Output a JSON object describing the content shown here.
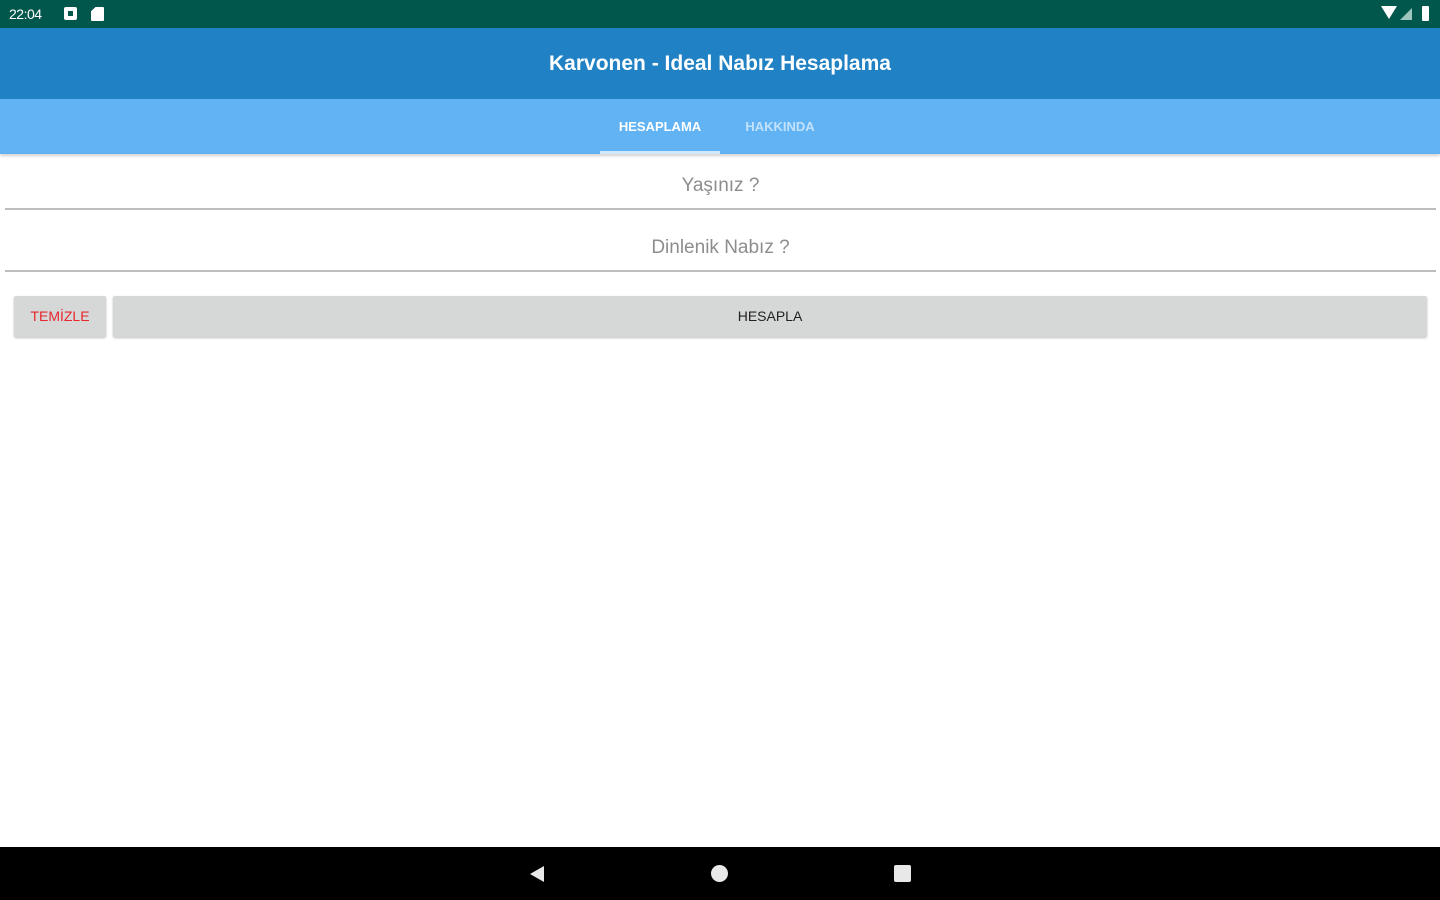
{
  "status_bar": {
    "time": "22:04",
    "icons": [
      "notification-icon",
      "sd-card-icon",
      "wifi-icon",
      "signal-icon",
      "battery-icon"
    ]
  },
  "app_bar": {
    "title": "Karvonen - Ideal Nabız Hesaplama",
    "color": "#2082c4"
  },
  "tabs": [
    {
      "label": "HESAPLAMA",
      "selected": true
    },
    {
      "label": "HAKKINDA",
      "selected": false
    }
  ],
  "form": {
    "age": {
      "value": "",
      "placeholder": "Yaşınız ?"
    },
    "resting_pulse": {
      "value": "",
      "placeholder": "Dinlenik Nabız ?"
    }
  },
  "buttons": {
    "clear_label": "TEMİZLE",
    "calculate_label": "HESAPLA"
  },
  "nav_bar": {
    "icons": [
      "back-icon",
      "home-icon",
      "recents-icon"
    ]
  },
  "colors": {
    "status_bar": "#01574b",
    "tab_bar": "#62b3f4",
    "clear_text": "#e8262b",
    "button_bg": "#d6d7d7"
  }
}
